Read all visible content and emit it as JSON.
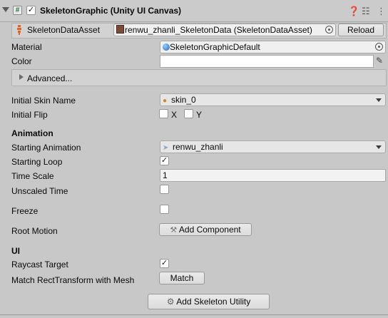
{
  "header": {
    "title": "SkeletonGraphic (Unity UI Canvas)",
    "enabled": "✓"
  },
  "skeleton_data": {
    "label": "SkeletonDataAsset",
    "value": "renwu_zhanli_SkeletonData (SkeletonDataAsset)",
    "reload_label": "Reload"
  },
  "material": {
    "label": "Material",
    "value": "SkeletonGraphicDefault"
  },
  "color": {
    "label": "Color",
    "swatch": "#ffffff"
  },
  "advanced": {
    "label": "Advanced..."
  },
  "initial_skin": {
    "label": "Initial Skin Name",
    "value": "skin_0"
  },
  "initial_flip": {
    "label": "Initial Flip",
    "x_label": "X",
    "y_label": "Y"
  },
  "animation": {
    "heading": "Animation",
    "starting_animation_label": "Starting Animation",
    "starting_animation_value": "renwu_zhanli",
    "starting_loop_label": "Starting Loop",
    "starting_loop_check": "✓",
    "time_scale_label": "Time Scale",
    "time_scale_value": "1",
    "unscaled_time_label": "Unscaled Time"
  },
  "freeze": {
    "label": "Freeze"
  },
  "root_motion": {
    "label": "Root Motion",
    "button_label": "Add Component"
  },
  "ui": {
    "heading": "UI",
    "raycast_label": "Raycast Target",
    "raycast_check": "✓",
    "match_label": "Match RectTransform with Mesh",
    "match_button": "Match"
  },
  "footer": {
    "add_utility_label": "Add Skeleton Utility"
  }
}
